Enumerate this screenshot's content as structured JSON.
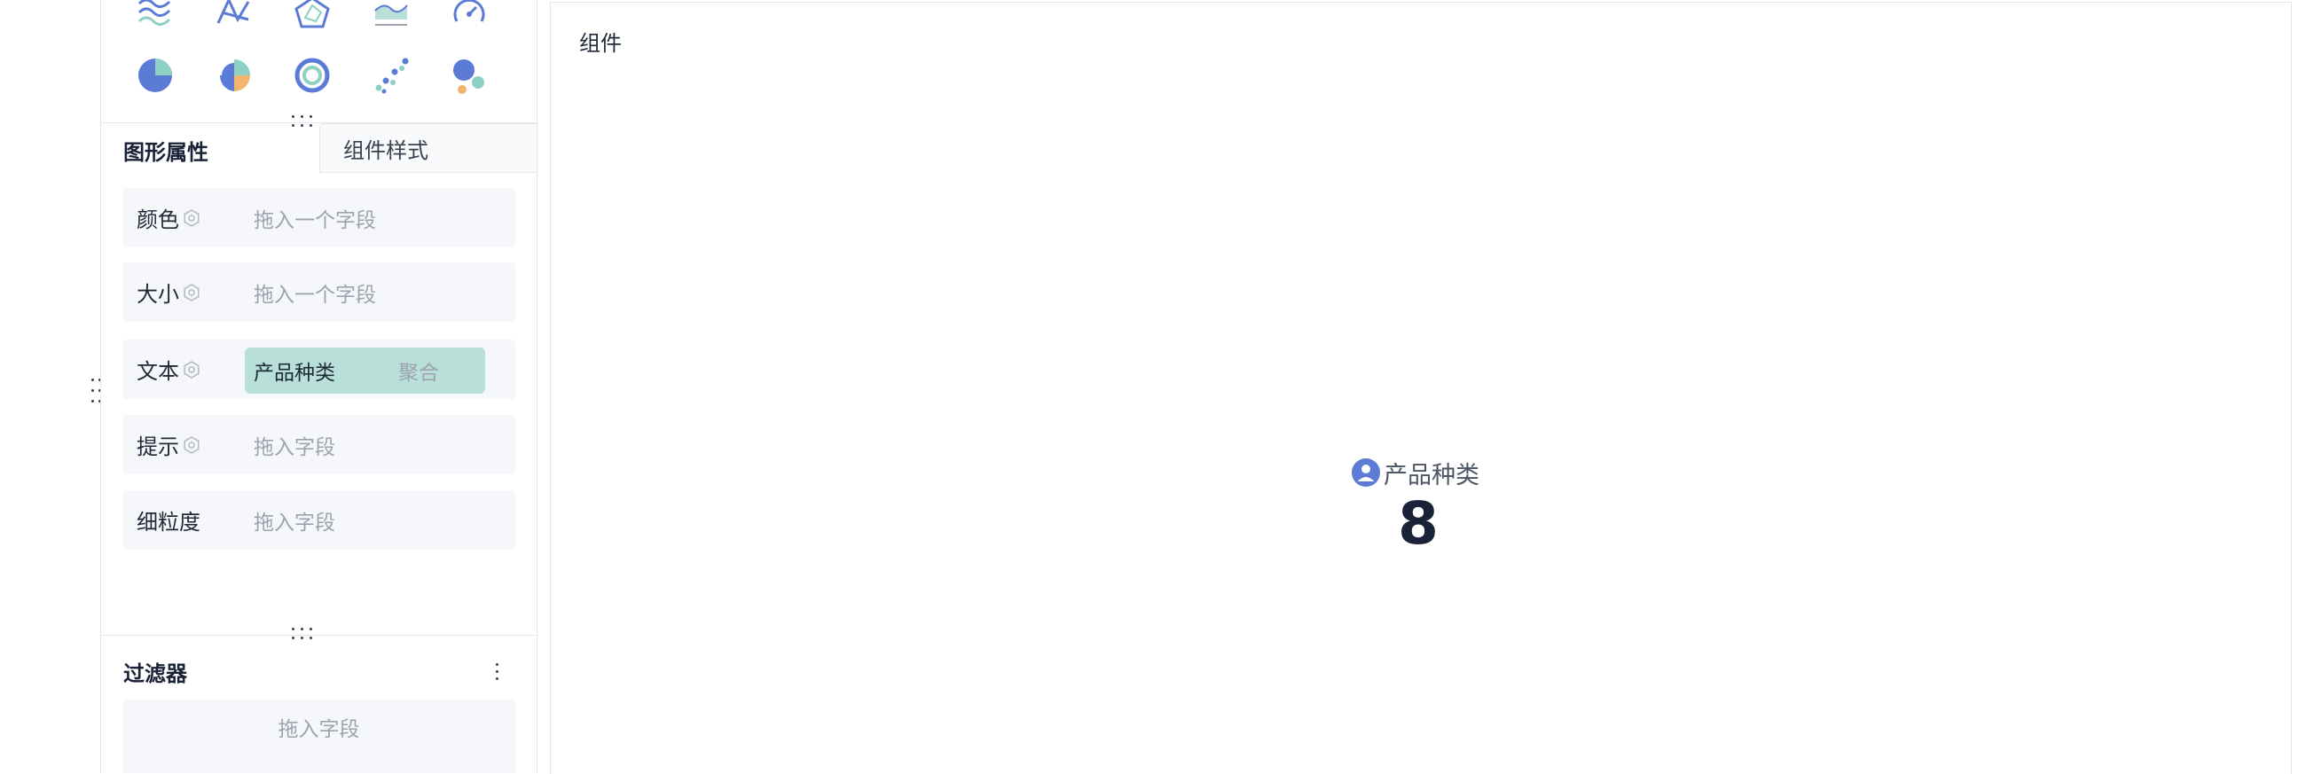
{
  "chart_types": [
    {
      "name": "multi-line-chart-icon"
    },
    {
      "name": "line-cross-chart-icon"
    },
    {
      "name": "radar-chart-icon"
    },
    {
      "name": "area-chart-icon"
    },
    {
      "name": "gauge-chart-icon"
    },
    {
      "name": "pie-chart-icon"
    },
    {
      "name": "rose-chart-icon"
    },
    {
      "name": "donut-chart-icon"
    },
    {
      "name": "scatter-chart-icon"
    },
    {
      "name": "bubble-chart-icon"
    }
  ],
  "tabs": {
    "graphic_props": "图形属性",
    "component_style": "组件样式"
  },
  "encodings": {
    "color": {
      "label": "颜色",
      "placeholder": "拖入一个字段"
    },
    "size": {
      "label": "大小",
      "placeholder": "拖入一个字段"
    },
    "text": {
      "label": "文本",
      "field": "产品种类",
      "aggregation": "聚合"
    },
    "tooltip": {
      "label": "提示",
      "placeholder": "拖入字段"
    },
    "granularity": {
      "label": "细粒度",
      "placeholder": "拖入字段"
    }
  },
  "filter": {
    "title": "过滤器",
    "placeholder": "拖入字段"
  },
  "canvas": {
    "title": "组件",
    "kpi_label": "产品种类",
    "kpi_value": "8"
  },
  "colors": {
    "accent": "#5b7bd5",
    "pill": "#b9dfd9",
    "row_bg": "#f6f7fa",
    "kpi": "#1a2238"
  }
}
